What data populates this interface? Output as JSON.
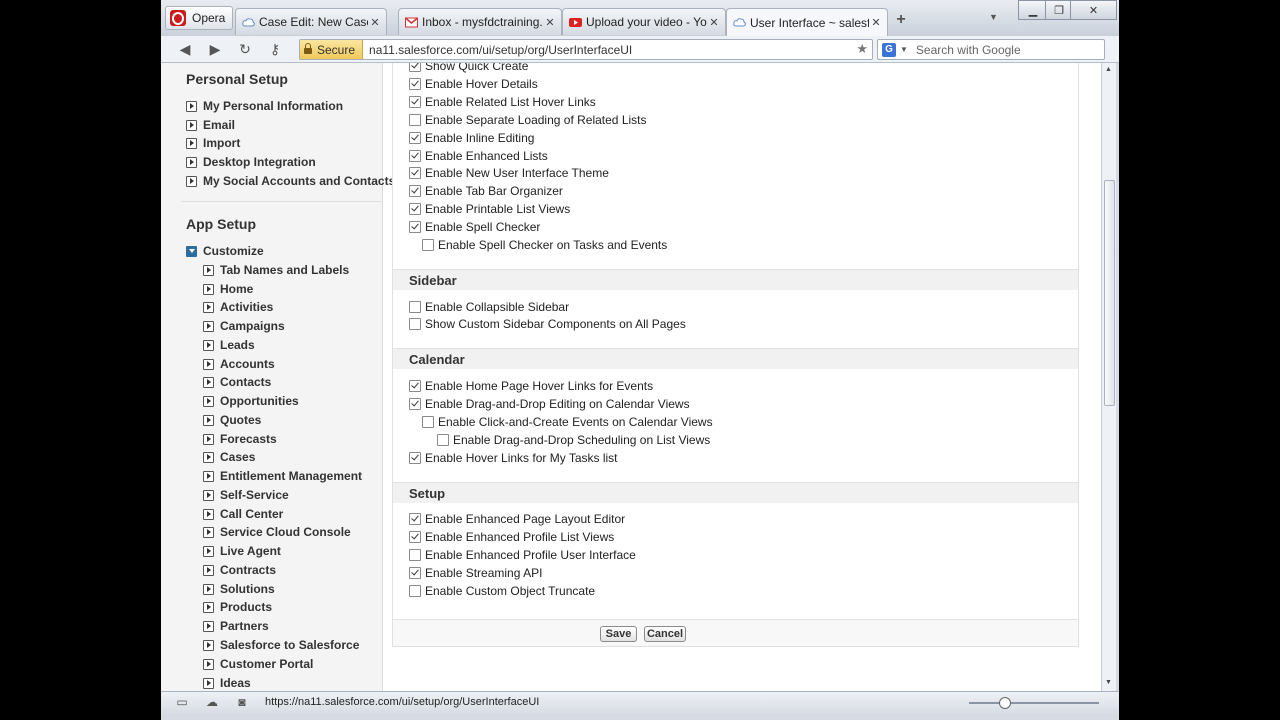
{
  "browser": {
    "menu_label": "Opera",
    "tabs": [
      {
        "label": "Case Edit: New Case ~ ...",
        "close": "✕"
      },
      {
        "label": "Inbox - mysfdctraining...",
        "close": "✕"
      },
      {
        "label": "Upload your video - Yo...",
        "close": "✕"
      },
      {
        "label": "User Interface ~ salesfo...",
        "close": "✕"
      }
    ],
    "new_tab": "+",
    "address": {
      "secure_label": "Secure",
      "url": "na11.salesforce.com/ui/setup/org/UserInterfaceUI"
    },
    "search": {
      "engine_icon": "G",
      "placeholder": "Search with Google"
    },
    "status_url": "https://na11.salesforce.com/ui/setup/org/UserInterfaceUI"
  },
  "sidebar": {
    "personal_setup_title": "Personal Setup",
    "personal_items": [
      "My Personal Information",
      "Email",
      "Import",
      "Desktop Integration",
      "My Social Accounts and Contacts"
    ],
    "app_setup_title": "App Setup",
    "customize_label": "Customize",
    "customize_items": [
      "Tab Names and Labels",
      "Home",
      "Activities",
      "Campaigns",
      "Leads",
      "Accounts",
      "Contacts",
      "Opportunities",
      "Quotes",
      "Forecasts",
      "Cases",
      "Entitlement Management",
      "Self-Service",
      "Call Center",
      "Service Cloud Console",
      "Live Agent",
      "Contracts",
      "Solutions",
      "Products",
      "Partners",
      "Salesforce to Salesforce",
      "Customer Portal",
      "Ideas"
    ]
  },
  "settings": {
    "general_items": [
      {
        "label": "Show Quick Create",
        "checked": true
      },
      {
        "label": "Enable Hover Details",
        "checked": true
      },
      {
        "label": "Enable Related List Hover Links",
        "checked": true
      },
      {
        "label": "Enable Separate Loading of Related Lists",
        "checked": false
      },
      {
        "label": "Enable Inline Editing",
        "checked": true
      },
      {
        "label": "Enable Enhanced Lists",
        "checked": true
      },
      {
        "label": "Enable New User Interface Theme",
        "checked": true
      },
      {
        "label": "Enable Tab Bar Organizer",
        "checked": true
      },
      {
        "label": "Enable Printable List Views",
        "checked": true
      },
      {
        "label": "Enable Spell Checker",
        "checked": true
      },
      {
        "label": "Enable Spell Checker on Tasks and Events",
        "checked": false
      }
    ],
    "sidebar_title": "Sidebar",
    "sidebar_items": [
      {
        "label": "Enable Collapsible Sidebar",
        "checked": false
      },
      {
        "label": "Show Custom Sidebar Components on All Pages",
        "checked": false
      }
    ],
    "calendar_title": "Calendar",
    "calendar_items": [
      {
        "label": "Enable Home Page Hover Links for Events",
        "checked": true
      },
      {
        "label": "Enable Drag-and-Drop Editing on Calendar Views",
        "checked": true
      },
      {
        "label": "Enable Click-and-Create Events on Calendar Views",
        "checked": false
      },
      {
        "label": "Enable Drag-and-Drop Scheduling on List Views",
        "checked": false
      },
      {
        "label": "Enable Hover Links for My Tasks list",
        "checked": true
      }
    ],
    "setup_title": "Setup",
    "setup_items": [
      {
        "label": "Enable Enhanced Page Layout Editor",
        "checked": true
      },
      {
        "label": "Enable Enhanced Profile List Views",
        "checked": true
      },
      {
        "label": "Enable Enhanced Profile User Interface",
        "checked": false
      },
      {
        "label": "Enable Streaming API",
        "checked": true
      },
      {
        "label": "Enable Custom Object Truncate",
        "checked": false
      }
    ],
    "save_label": "Save",
    "cancel_label": "Cancel"
  }
}
